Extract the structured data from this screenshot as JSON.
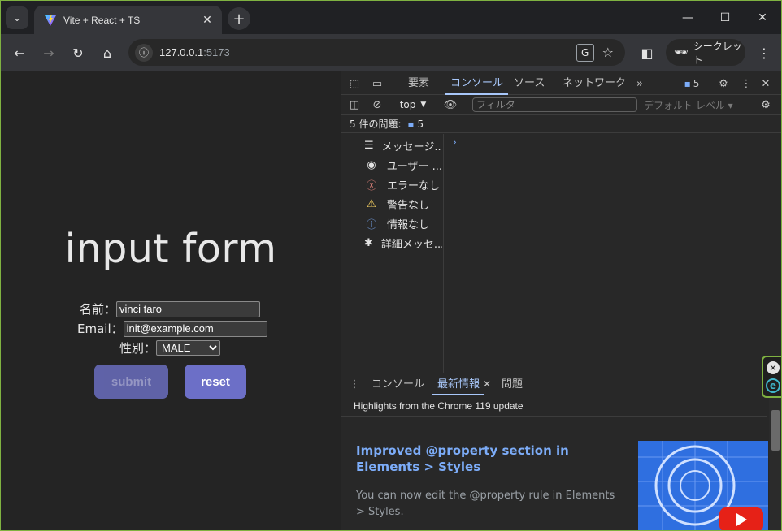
{
  "browser": {
    "tab": {
      "title": "Vite + React + TS",
      "close": "✕"
    },
    "new_tab": "+",
    "window_controls": {
      "minimize": "—",
      "maximize": "☐",
      "close": "✕"
    },
    "address": {
      "host": "127.0.0.1",
      "port": ":5173"
    },
    "incognito_label": "シークレット"
  },
  "page": {
    "heading": "input form",
    "fields": {
      "name_label": "名前：",
      "name_value": "vinci taro",
      "email_label": "Email：",
      "email_value": "init@example.com",
      "gender_label": "性別：",
      "gender_selected": "MALE"
    },
    "buttons": {
      "submit": "submit",
      "reset": "reset"
    }
  },
  "devtools": {
    "tabs": [
      "要素",
      "コンソール",
      "ソース",
      "ネットワーク"
    ],
    "active_tab": "コンソール",
    "issue_count_badge": "5",
    "context": "top",
    "filter_placeholder": "フィルタ",
    "levels": "デフォルト レベル ▾",
    "issues_text": "5 件の問題:",
    "issues_count": "5",
    "sidebar": [
      {
        "icon": "list-icon",
        "label": "メッセージ..."
      },
      {
        "icon": "user-icon",
        "label": "ユーザー ..."
      },
      {
        "icon": "error-icon",
        "label": "エラーなし"
      },
      {
        "icon": "warning-icon",
        "label": "警告なし"
      },
      {
        "icon": "info-icon",
        "label": "情報なし"
      },
      {
        "icon": "bug-icon",
        "label": "詳細メッセ..."
      }
    ],
    "drawer": {
      "tabs": [
        "コンソール",
        "最新情報",
        "問題"
      ],
      "active": "最新情報",
      "header": "Highlights from the Chrome 119 update",
      "article_title": "Improved @property section in Elements > Styles",
      "article_body": "You can now edit the @property rule in Elements > Styles."
    }
  },
  "colors": {
    "accent_button": "#6c6fc7",
    "devtools_active": "#a8c7fa",
    "link_blue": "#7cacf8",
    "window_border": "#7fb241"
  }
}
